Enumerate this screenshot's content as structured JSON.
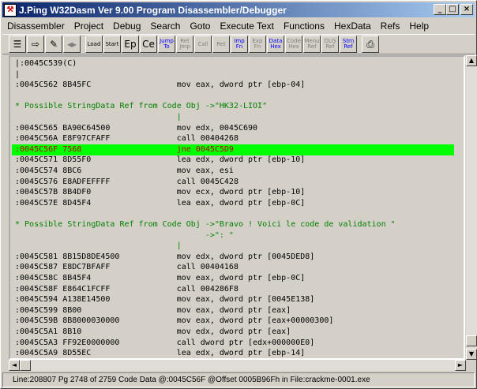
{
  "window": {
    "title": "J.Ping W32Dasm Ver 9.00 Program Disassembler/Debugger",
    "app_icon_glyph": "⚒"
  },
  "caption_buttons": {
    "minimize": "_",
    "maximize": "□",
    "close": "×"
  },
  "menu": [
    "Disassembler",
    "Project",
    "Debug",
    "Search",
    "Goto",
    "Execute Text",
    "Functions",
    "HexData",
    "Refs",
    "Help"
  ],
  "toolbar": [
    {
      "label": "☰",
      "name": "open-icon"
    },
    {
      "label": "⇨",
      "name": "save-icon"
    },
    {
      "label": "✎",
      "name": "copy-icon"
    },
    {
      "label": "◂▸",
      "name": "jump-code-icon",
      "disabled": true
    },
    {
      "label": "Load",
      "name": "load-process-icon"
    },
    {
      "label": "Start",
      "name": "start-icon"
    },
    {
      "label": "Ep",
      "name": "entry-point-icon"
    },
    {
      "label": "Ce",
      "name": "code-entry-icon"
    },
    {
      "label": "Jump To",
      "name": "jump-to-icon",
      "blue": true
    },
    {
      "label": "Ret Jmp",
      "name": "return-jump-icon",
      "disabled": true
    },
    {
      "label": "Call",
      "name": "call-icon",
      "disabled": true
    },
    {
      "label": "Ret",
      "name": "return-call-icon",
      "disabled": true
    },
    {
      "label": "Imp Fn",
      "name": "imports-icon",
      "blue": true
    },
    {
      "label": "Exp Fn",
      "name": "exports-icon",
      "disabled": true
    },
    {
      "label": "Data Hex",
      "name": "hex-data-icon",
      "blue": true
    },
    {
      "label": "Code Hex",
      "name": "hex-code-icon",
      "disabled": true
    },
    {
      "label": "Menu Ref",
      "name": "menu-ref-icon",
      "disabled": true
    },
    {
      "label": "DLG Ref",
      "name": "dialog-ref-icon",
      "disabled": true
    },
    {
      "label": "Strn Ref",
      "name": "string-ref-icon",
      "blue": true
    },
    {
      "label": "⎙",
      "name": "print-icon"
    }
  ],
  "listing": [
    {
      "text": "|:0045C539(C)",
      "kind": "code"
    },
    {
      "text": "|",
      "kind": "code"
    },
    {
      "text": ":0045C562 8B45FC                  mov eax, dword ptr [ebp-04]",
      "kind": "code"
    },
    {
      "text": "",
      "kind": "code"
    },
    {
      "text": "* Possible StringData Ref from Code Obj ->\"HK32-LIOI\"",
      "kind": "ref"
    },
    {
      "text": "                                  |",
      "kind": "ref"
    },
    {
      "text": ":0045C565 BA90C64500              mov edx, 0045C690",
      "kind": "code"
    },
    {
      "text": ":0045C56A E8F97CFAFF              call 00404268",
      "kind": "code"
    },
    {
      "text": ":0045C56F 7568                    jne 0045C5D9",
      "kind": "hl"
    },
    {
      "text": ":0045C571 8D55F0                  lea edx, dword ptr [ebp-10]",
      "kind": "code"
    },
    {
      "text": ":0045C574 8BC6                    mov eax, esi",
      "kind": "code"
    },
    {
      "text": ":0045C576 E8ADFEFFFF              call 0045C428",
      "kind": "code"
    },
    {
      "text": ":0045C57B 8B4DF0                  mov ecx, dword ptr [ebp-10]",
      "kind": "code"
    },
    {
      "text": ":0045C57E 8D45F4                  lea eax, dword ptr [ebp-0C]",
      "kind": "code"
    },
    {
      "text": "",
      "kind": "code"
    },
    {
      "text": "* Possible StringData Ref from Code Obj ->\"Bravo ! Voici le code de validation \"",
      "kind": "ref"
    },
    {
      "text": "                                        ->\": \"",
      "kind": "ref"
    },
    {
      "text": "                                  |",
      "kind": "ref"
    },
    {
      "text": ":0045C581 8B15D8DE4500            mov edx, dword ptr [0045DED8]",
      "kind": "code"
    },
    {
      "text": ":0045C587 E8DC7BFAFF              call 00404168",
      "kind": "code"
    },
    {
      "text": ":0045C58C 8B45F4                  mov eax, dword ptr [ebp-0C]",
      "kind": "code"
    },
    {
      "text": ":0045C58F E864C1FCFF              call 004286F8",
      "kind": "code"
    },
    {
      "text": ":0045C594 A138E14500              mov eax, dword ptr [0045E138]",
      "kind": "code"
    },
    {
      "text": ":0045C599 8B00                    mov eax, dword ptr [eax]",
      "kind": "code"
    },
    {
      "text": ":0045C59B 8B8000030000            mov eax, dword ptr [eax+00000300]",
      "kind": "code"
    },
    {
      "text": ":0045C5A1 8B10                    mov edx, dword ptr [eax]",
      "kind": "code"
    },
    {
      "text": ":0045C5A3 FF92E0000000            call dword ptr [edx+000000E0]",
      "kind": "code"
    },
    {
      "text": ":0045C5A9 8D55EC                  lea edx, dword ptr [ebp-14]",
      "kind": "code"
    }
  ],
  "scroll": {
    "up": "▲",
    "down": "▼",
    "left": "◄",
    "right": "►",
    "vertical_position": 0.99
  },
  "status": "Line:208807 Pg 2748 of 2759  Code Data @:0045C56F @Offset 0005B96Fh in File:crackme-0001.exe",
  "colors": {
    "highlight": "#00ff00",
    "highlight_text": "#c00000",
    "string_ref": "#008000"
  }
}
